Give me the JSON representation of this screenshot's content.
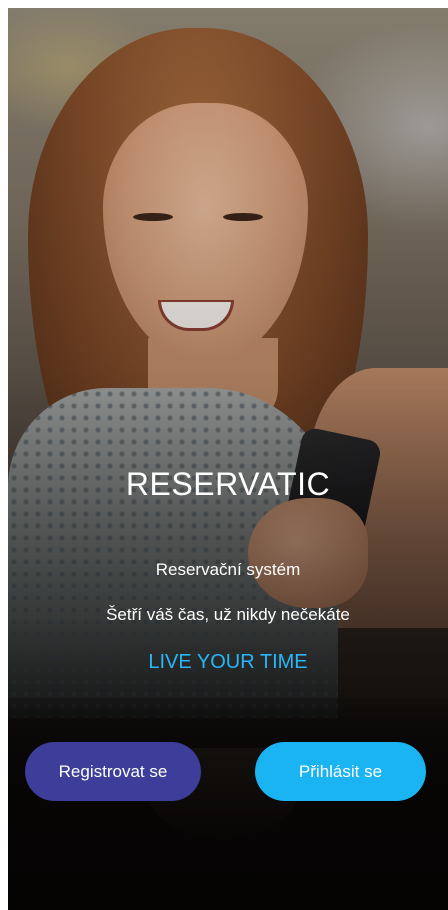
{
  "app": {
    "title": "RESERVATIC",
    "subtitle": "Reservační systém",
    "tagline": "Šetří váš čas, už nikdy nečekáte",
    "slogan": "LIVE YOUR TIME"
  },
  "actions": {
    "register_label": "Registrovat se",
    "login_label": "Přihlásit se"
  },
  "colors": {
    "register_button": "#3d3d9a",
    "login_button": "#1ab4f3",
    "slogan": "#29b6f6"
  }
}
